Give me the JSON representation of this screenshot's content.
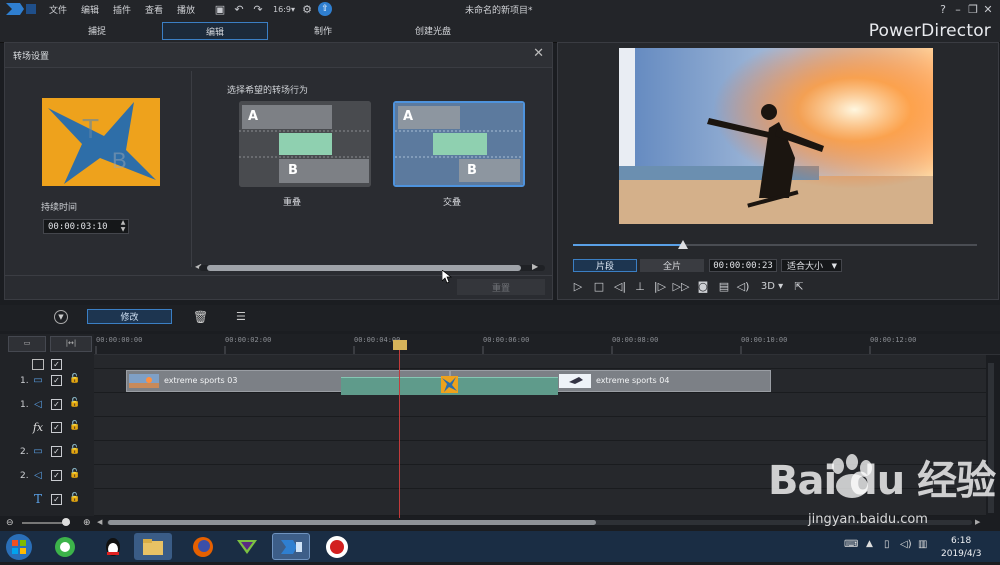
{
  "menu": {
    "items": [
      "文件",
      "编辑",
      "插件",
      "查看",
      "播放"
    ],
    "doc_title": "未命名的新项目*",
    "help": "?"
  },
  "modes": {
    "tabs": [
      "捕捉",
      "编辑",
      "制作",
      "创建光盘"
    ],
    "active": "编辑",
    "brand": "PowerDirector"
  },
  "transition_panel": {
    "title": "转场设置",
    "duration_label": "持续时间",
    "duration_value": "00:00:03:10",
    "choose_label": "选择希望的转场行为",
    "behaviors": [
      {
        "label": "重叠",
        "a": "A",
        "b": "B"
      },
      {
        "label": "交叠",
        "a": "A",
        "b": "B"
      }
    ],
    "reset_label": "重置"
  },
  "preview": {
    "tab_clip": "片段",
    "tab_full": "全片",
    "time": "00:00:00:23",
    "fit": "适合大小",
    "mode_3d": "3D"
  },
  "timeline": {
    "modify_label": "修改",
    "ruler": [
      "00:00:00:00",
      "00:00:02:00",
      "00:00:04:00",
      "00:00:06:00",
      "00:00:08:00",
      "00:00:10:00",
      "00:00:12:00"
    ],
    "tracks": [
      {
        "num": "",
        "icon": "track-all-icon"
      },
      {
        "num": "1.",
        "icon": "video-track-icon"
      },
      {
        "num": "1.",
        "icon": "audio-track-icon"
      },
      {
        "num": "",
        "icon": "fx-icon",
        "label": "fx"
      },
      {
        "num": "2.",
        "icon": "video-track-icon"
      },
      {
        "num": "2.",
        "icon": "audio-track-icon"
      },
      {
        "num": "",
        "icon": "text-track-icon",
        "label": "T"
      }
    ],
    "clip1": "extreme sports 03",
    "clip2": "extreme sports 04"
  },
  "taskbar": {
    "time": "6:18",
    "date": "2019/4/3"
  },
  "watermark": {
    "main": "Bai du 经验",
    "sub": "jingyan.baidu.com"
  },
  "colors": {
    "accent": "#3b7fc4",
    "transition": "#5f9b8b",
    "playhead": "#c23b3b"
  }
}
